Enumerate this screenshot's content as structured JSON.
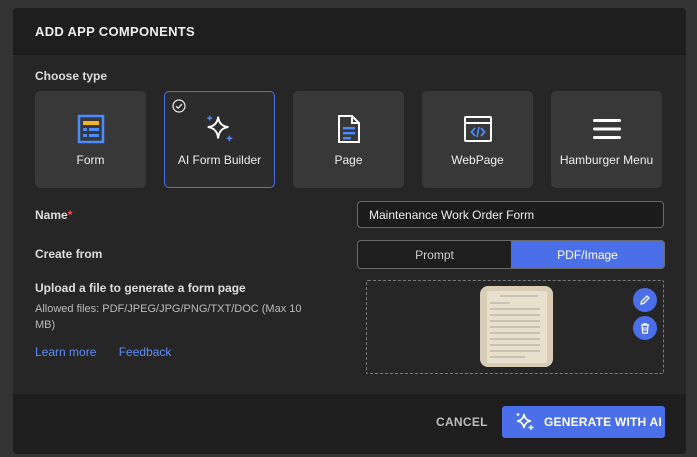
{
  "modal": {
    "title": "ADD APP COMPONENTS",
    "choose_type_label": "Choose type",
    "types": [
      {
        "label": "Form",
        "icon": "form-icon",
        "selected": false
      },
      {
        "label": "AI Form Builder",
        "icon": "sparkle-icon",
        "selected": true
      },
      {
        "label": "Page",
        "icon": "page-icon",
        "selected": false
      },
      {
        "label": "WebPage",
        "icon": "webpage-icon",
        "selected": false
      },
      {
        "label": "Hamburger Menu",
        "icon": "hamburger-menu-icon",
        "selected": false
      }
    ],
    "name_label": "Name",
    "name_value": "Maintenance Work Order Form",
    "create_from_label": "Create from",
    "create_from_options": [
      "Prompt",
      "PDF/Image"
    ],
    "create_from_selected": "PDF/Image",
    "upload_title": "Upload a file to generate a form page",
    "upload_help": "Allowed files: PDF/JPEG/JPG/PNG/TXT/DOC (Max 10 MB)",
    "learn_more": "Learn more",
    "feedback": "Feedback",
    "cancel_label": "CANCEL",
    "generate_label": "GENERATE WITH AI"
  },
  "colors": {
    "accent": "#4a6fe8",
    "required": "#ff4d4d",
    "link": "#5a8cff"
  }
}
